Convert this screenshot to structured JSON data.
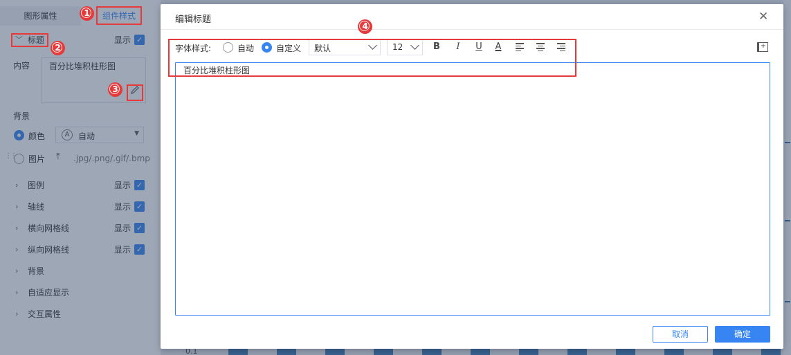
{
  "left_panel": {
    "tabs": {
      "chart_props": "图形属性",
      "component_style": "组件样式"
    },
    "title_section": {
      "label": "标题",
      "show": "显示"
    },
    "content": {
      "label": "内容",
      "value": "百分比堆积柱形图"
    },
    "background": {
      "label": "背景",
      "color_option": "颜色",
      "color_mode_icon": "A",
      "color_mode": "自动",
      "image_option": "图片",
      "image_formats": ".jpg/.png/.gif/.bmp"
    },
    "sections": [
      {
        "label": "图例",
        "show": "显示"
      },
      {
        "label": "轴线",
        "show": "显示"
      },
      {
        "label": "横向网格线",
        "show": "显示"
      },
      {
        "label": "纵向网格线",
        "show": "显示"
      },
      {
        "label": "背景"
      },
      {
        "label": "自适应显示"
      },
      {
        "label": "交互属性"
      }
    ]
  },
  "background_chart": {
    "tick_label": "0.1"
  },
  "dialog": {
    "title": "编辑标题",
    "toolbar": {
      "font_style_label": "字体样式:",
      "radio_auto": "自动",
      "radio_custom": "自定义",
      "font_family": "默认",
      "font_size": "12",
      "bold_glyph": "B",
      "italic_glyph": "I",
      "underline_glyph": "U",
      "font_color_glyph": "A"
    },
    "editor_text": "百分比堆积柱形图",
    "cancel": "取消",
    "confirm": "确定"
  },
  "annotations": [
    "1",
    "2",
    "3",
    "4"
  ],
  "colors": {
    "accent": "#3685f2",
    "annotation": "#e63a3a",
    "overlay": "rgba(52,72,102,0.48)"
  }
}
